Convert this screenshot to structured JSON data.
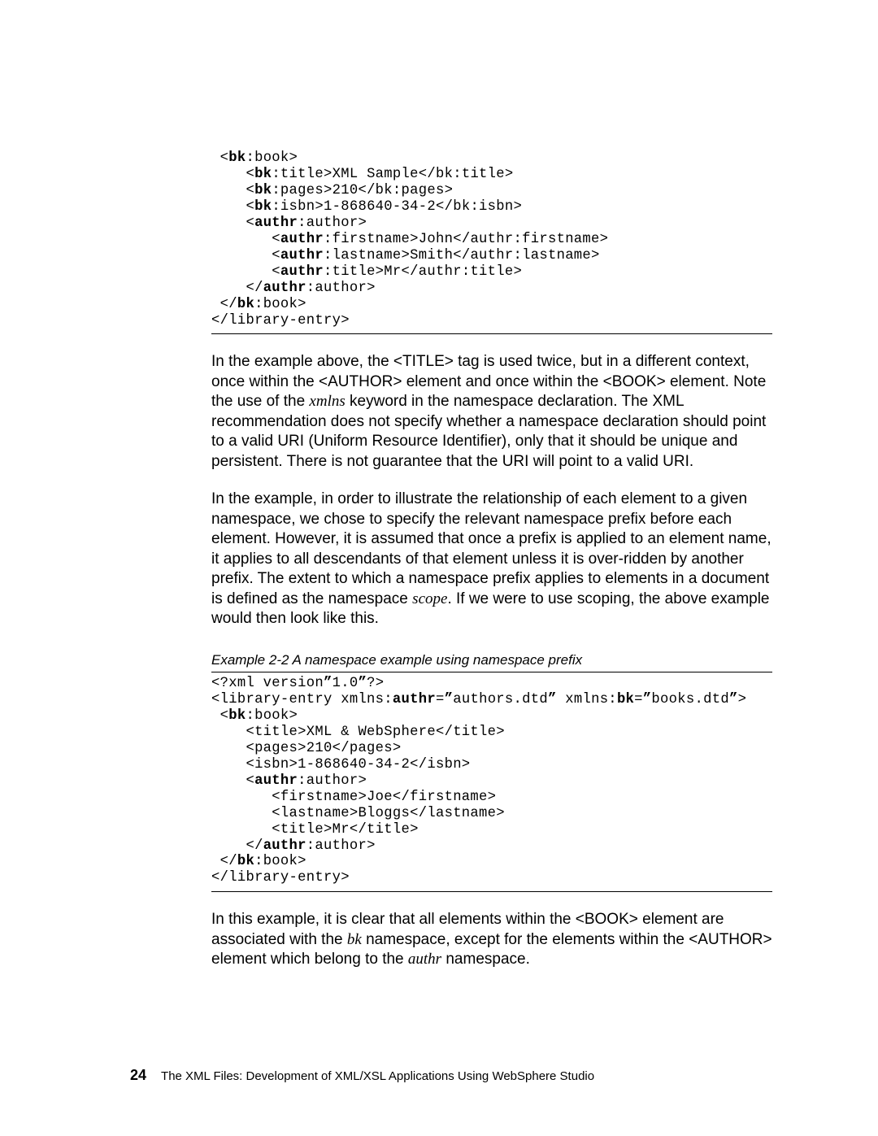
{
  "code1": {
    "l01a": " <",
    "l01b": "bk",
    "l01c": ":book>",
    "l02a": "    <",
    "l02b": "bk",
    "l02c": ":title>XML Sample</bk:title>",
    "l03a": "    <",
    "l03b": "bk",
    "l03c": ":pages>210</bk:pages>",
    "l04a": "    <",
    "l04b": "bk",
    "l04c": ":isbn>1-868640-34-2</bk:isbn>",
    "l05a": "    <",
    "l05b": "authr",
    "l05c": ":author>",
    "l06a": "       <",
    "l06b": "authr",
    "l06c": ":firstname>John</authr:firstname>",
    "l07a": "       <",
    "l07b": "authr",
    "l07c": ":lastname>Smith</authr:lastname>",
    "l08a": "       <",
    "l08b": "authr",
    "l08c": ":title>Mr</authr:title>",
    "l09a": "    </",
    "l09b": "authr",
    "l09c": ":author>",
    "l10a": " </",
    "l10b": "bk",
    "l10c": ":book>",
    "l11": "</library-entry>"
  },
  "para1": {
    "t1": "In the example above, the <TITLE> tag is used twice, but in a different context, once within the <AUTHOR> element and once within the <BOOK> element. Note the use of the ",
    "i1": "xmlns",
    "t2": " keyword in the namespace declaration. The XML recommendation does not specify whether a namespace declaration should point to a valid URI (Uniform Resource Identifier), only that it should be unique and persistent. There is not guarantee that the URI will point to a valid URI."
  },
  "para2": {
    "t1": "In the example, in order to illustrate the relationship of each element to a given namespace, we chose to specify the relevant namespace prefix before each element. However, it is assumed that once a prefix is applied to an element name, it applies to all descendants of that element unless it is over-ridden by another prefix. The extent to which a namespace prefix applies to elements in a document is defined as the namespace ",
    "i1": "scope",
    "t2": ". If we were to use scoping, the above example would then look like this."
  },
  "caption": "Example 2-2   A namespace example using namespace prefix",
  "code2": {
    "l01a": "<?xml version",
    "l01b": "”",
    "l01c": "1.0",
    "l01d": "”",
    "l01e": "?>",
    "l02a": "<library-entry xmlns:",
    "l02b": "authr",
    "l02c": "=",
    "l02d": "”",
    "l02e": "authors.dtd",
    "l02f": "”",
    "l02g": " xmlns:",
    "l02h": "bk",
    "l02i": "=",
    "l02j": "”",
    "l02k": "books.dtd",
    "l02l": "”",
    "l02m": ">",
    "l03a": " <",
    "l03b": "bk",
    "l03c": ":book>",
    "l04": "    <title>XML & WebSphere</title>",
    "l05": "    <pages>210</pages>",
    "l06": "    <isbn>1-868640-34-2</isbn>",
    "l07a": "    <",
    "l07b": "authr",
    "l07c": ":author>",
    "l08": "       <firstname>Joe</firstname>",
    "l09": "       <lastname>Bloggs</lastname>",
    "l10": "       <title>Mr</title>",
    "l11a": "    </",
    "l11b": "authr",
    "l11c": ":author>",
    "l12a": " </",
    "l12b": "bk",
    "l12c": ":book>",
    "l13": "</library-entry>"
  },
  "para3": {
    "t1": "In this example, it is clear that all elements within the <BOOK> element are associated with the ",
    "i1": "bk",
    "t2": " namespace, except for the elements within the <AUTHOR> element which belong to the ",
    "i2": "authr",
    "t3": " namespace."
  },
  "footer": {
    "page_num": "24",
    "title": "The XML Files:  Development of XML/XSL Applications Using WebSphere Studio"
  }
}
